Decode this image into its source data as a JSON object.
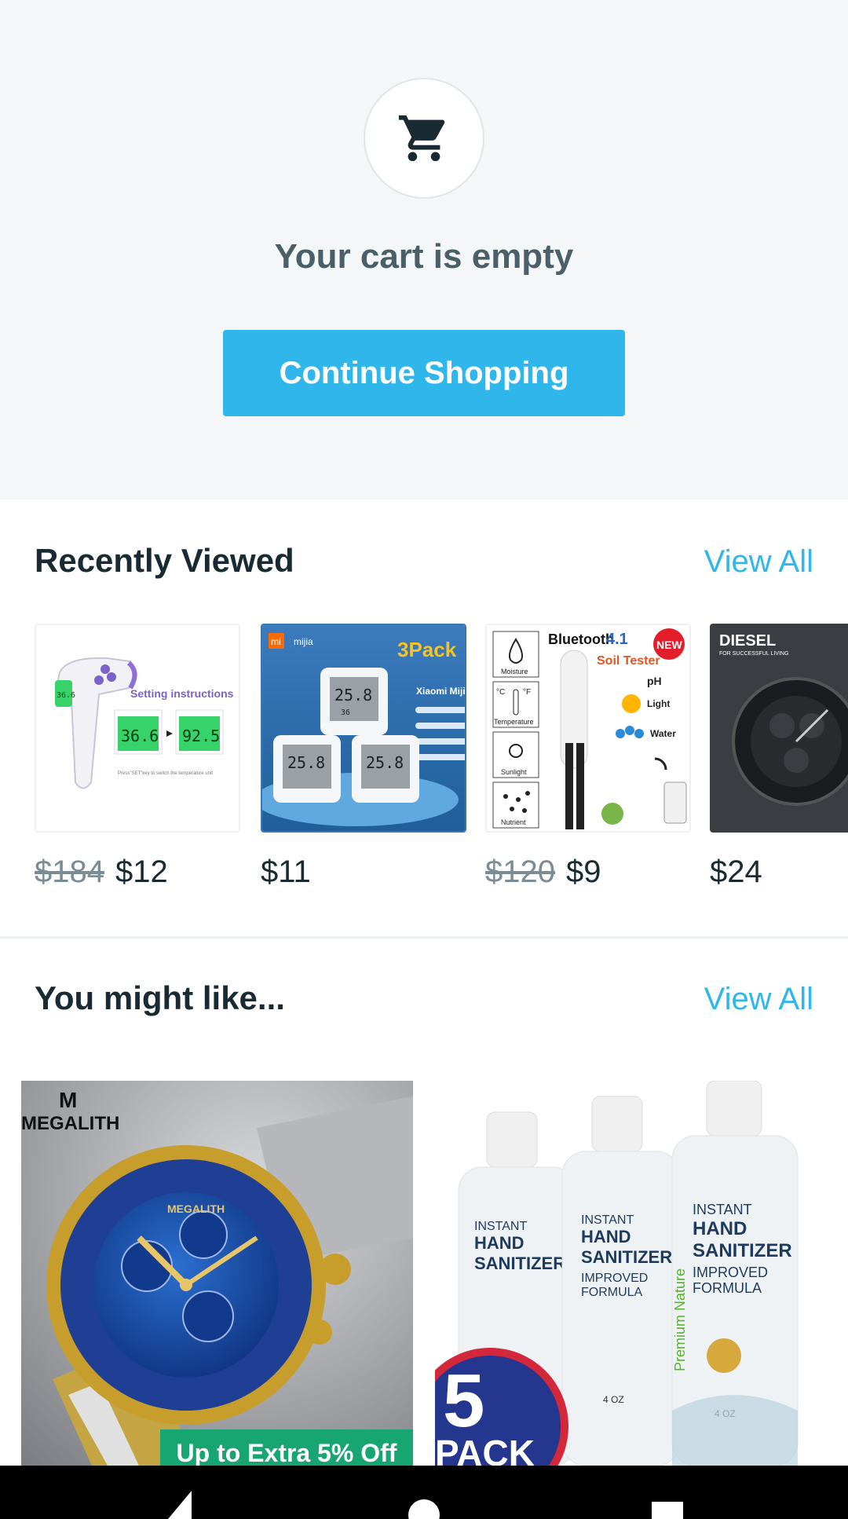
{
  "empty_cart": {
    "icon": "shopping-cart-icon",
    "title": "Your cart is empty",
    "button_label": "Continue Shopping"
  },
  "recently_viewed": {
    "title": "Recently Viewed",
    "view_all_label": "View All",
    "items": [
      {
        "image": "infrared-thermometer",
        "old_price": "$184",
        "price": "$12",
        "image_text": {
          "caption": "Setting instructions",
          "reading_a": "36.6",
          "reading_b": "92.5",
          "note": "Press\"SET\"key to switch the temperature unit"
        }
      },
      {
        "image": "xiaomi-mijia-thermometer-3pack",
        "old_price": "",
        "price": "$11",
        "image_text": {
          "brand": "mijia",
          "pack": "3Pack",
          "name": "Xiaomi Mijia",
          "reading": "25.8",
          "humidity": "36"
        }
      },
      {
        "image": "bluetooth-soil-tester",
        "old_price": "$120",
        "price": "$9",
        "image_text": {
          "header": "Bluetooth",
          "version": "4.1",
          "badge": "NEW",
          "title": "Soil Tester",
          "labels": [
            "Moisture",
            "Temperature",
            "Sunlight",
            "Nutrient"
          ],
          "features": [
            "pH",
            "Light",
            "Water"
          ]
        }
      },
      {
        "image": "diesel-watch",
        "old_price": "",
        "price": "$24",
        "image_text": {
          "brand": "DIESEL",
          "tagline": "FOR SUCCESSFUL LIVING"
        }
      }
    ]
  },
  "you_might_like": {
    "title": "You might like...",
    "view_all_label": "View All",
    "items": [
      {
        "image": "megalith-watch",
        "brand": "MEGALITH",
        "badge": "Up to Extra 5% Off"
      },
      {
        "image": "hand-sanitizer-5pack",
        "product_lines": [
          "INSTANT",
          "HAND",
          "SANITIZER",
          "IMPROVED",
          "FORMULA"
        ],
        "brand": "Premium Nature",
        "size": "4 OZ",
        "pack_number": "5",
        "pack_label": "PACK"
      }
    ]
  },
  "colors": {
    "accent": "#2fb7ec",
    "discount_badge": "#17a572",
    "heading": "#192a32",
    "muted": "#4b5f69"
  }
}
